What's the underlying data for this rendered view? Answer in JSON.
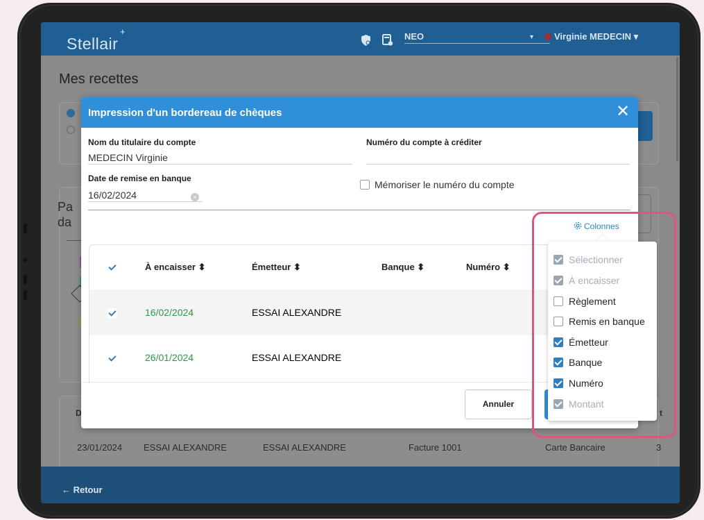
{
  "app": {
    "logo": "Stellair",
    "logo_mark": "+",
    "workspace": "NEO",
    "user": "Virginie MEDECIN",
    "user_arrow": "▾",
    "workspace_arrow": "▾"
  },
  "page": {
    "title": "Mes recettes",
    "bg_fragment_1": "Pa",
    "bg_fragment_2": "da",
    "bg_table_label": "D",
    "bg_row": {
      "date": "23/01/2024",
      "col2": "ESSAI ALEXANDRE",
      "col3": "ESSAI ALEXANDRE",
      "col4": "Facture 1001",
      "col5": "Carte Bancaire",
      "col6": "3"
    },
    "bg_right_char": "t",
    "footer_back": "← Retour"
  },
  "modal": {
    "title": "Impression d'un bordereau de chèques",
    "close": "✕",
    "account_holder_label": "Nom du titulaire du compte",
    "account_holder_value": "MEDECIN Virginie",
    "account_number_label": "Numéro du compte à créditer",
    "account_number_value": "",
    "deposit_date_label": "Date de remise en banque",
    "deposit_date_value": "16/02/2024",
    "remember_label": "Mémoriser le numéro du compte",
    "columns_button": "Colonnes",
    "table": {
      "headers": [
        "À encaisser ⬍",
        "Émetteur ⬍",
        "Banque ⬍",
        "Numéro ⬍"
      ],
      "rows": [
        {
          "date": "16/02/2024",
          "emitter": "ESSAI ALEXANDRE",
          "bank": "",
          "number": ""
        },
        {
          "date": "26/01/2024",
          "emitter": "ESSAI ALEXANDRE",
          "bank": "",
          "number": ""
        }
      ]
    },
    "cancel_button": "Annuler"
  },
  "columns_menu": [
    {
      "label": "Sélectionner",
      "checked": true,
      "disabled": true
    },
    {
      "label": "À encaisser",
      "checked": true,
      "disabled": true
    },
    {
      "label": "Règlement",
      "checked": false,
      "disabled": false
    },
    {
      "label": "Remis en banque",
      "checked": false,
      "disabled": false
    },
    {
      "label": "Émetteur",
      "checked": true,
      "disabled": false
    },
    {
      "label": "Banque",
      "checked": true,
      "disabled": false
    },
    {
      "label": "Numéro",
      "checked": true,
      "disabled": false
    },
    {
      "label": "Montant",
      "checked": true,
      "disabled": true
    }
  ],
  "colors": {
    "appbar": "#1f5f93",
    "modal_header": "#2f8fd8",
    "accent": "#2f7fc0",
    "date_green": "#2a9a4a",
    "highlight": "#e0567a"
  }
}
